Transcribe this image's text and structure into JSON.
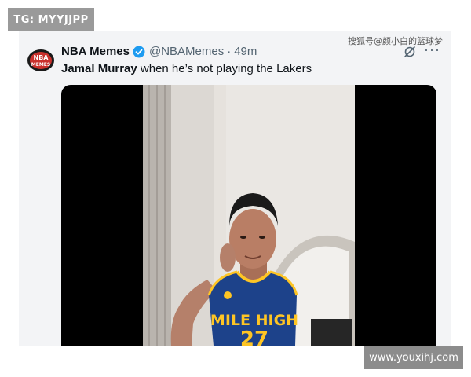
{
  "watermarks": {
    "top_left": "TG: MYYJJPP",
    "source": "搜狐号@颜小白的篮球梦",
    "site": "www.youxihj.com"
  },
  "tweet": {
    "avatar_text_line1": "NBA",
    "avatar_text_line2": "MEMES",
    "author": "NBA Memes",
    "handle": "@NBAMemes",
    "separator": "·",
    "time": "49m",
    "text_bold": "Jamal Murray",
    "text_rest": " when he’s not playing the Lakers",
    "more": "···",
    "verified_color": "#1d9bf0"
  },
  "video": {
    "jersey_text": "MILE HIGH",
    "jersey_number": "27",
    "jersey_logo": "jumpman-icon"
  }
}
